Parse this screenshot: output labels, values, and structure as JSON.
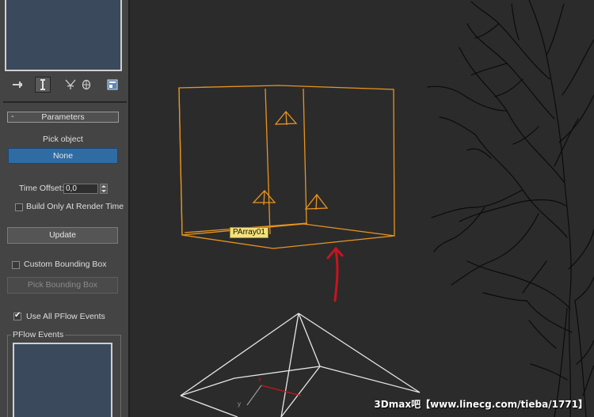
{
  "panel": {
    "rollout_title": "Parameters",
    "rollout_toggle": "-",
    "pick_object_label": "Pick object",
    "pick_button": "None",
    "time_offset_label": "Time Offset:",
    "time_offset_value": "0,0",
    "build_only_label": "Build Only At Render Time",
    "build_only_checked": false,
    "update_button": "Update",
    "custom_bbox_label": "Custom Bounding Box",
    "custom_bbox_checked": false,
    "pick_bbox_button": "Pick Bounding Box",
    "use_all_label": "Use All PFlow Events",
    "use_all_checked": true,
    "pflow_events_label": "PFlow Events",
    "command_icons": [
      "pin-stack-icon",
      "modifier-icon",
      "branch-icon",
      "wheel-icon",
      "configure-icon"
    ]
  },
  "viewport": {
    "object_label": "PArray01",
    "watermark": "3Dmax吧【www.linecg.com/tieba/1771】",
    "colors": {
      "selection": "#e8941e",
      "wire": "#e6e6e6",
      "annotation": "#c8141e",
      "tree": "#0b0b0b"
    }
  }
}
